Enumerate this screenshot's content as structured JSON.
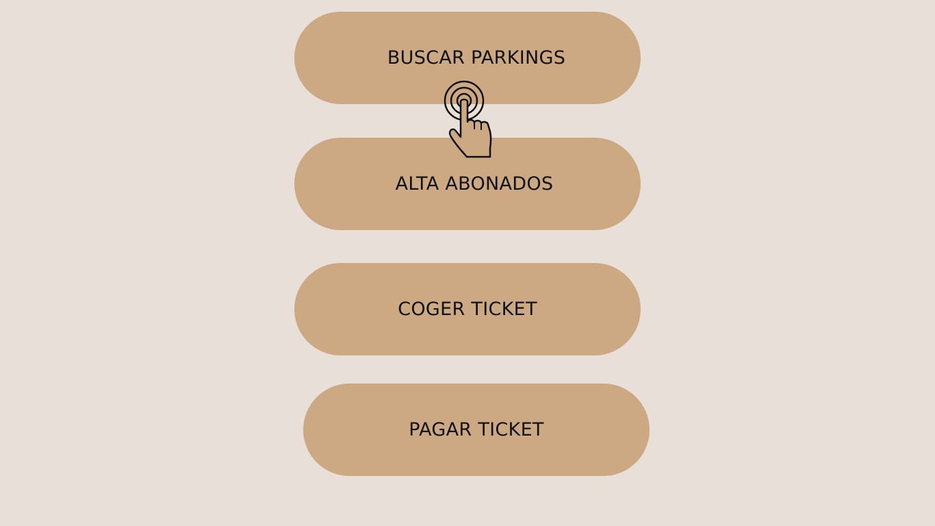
{
  "menu": {
    "buttons": [
      {
        "label": "BUSCAR PARKINGS"
      },
      {
        "label": "ALTA ABONADOS"
      },
      {
        "label": "COGER TICKET"
      },
      {
        "label": "PAGAR TICKET"
      }
    ]
  },
  "icons": {
    "tap": "tap-hand-icon"
  },
  "colors": {
    "background": "#e8dfd9",
    "button": "#cca983",
    "text": "#111111"
  }
}
